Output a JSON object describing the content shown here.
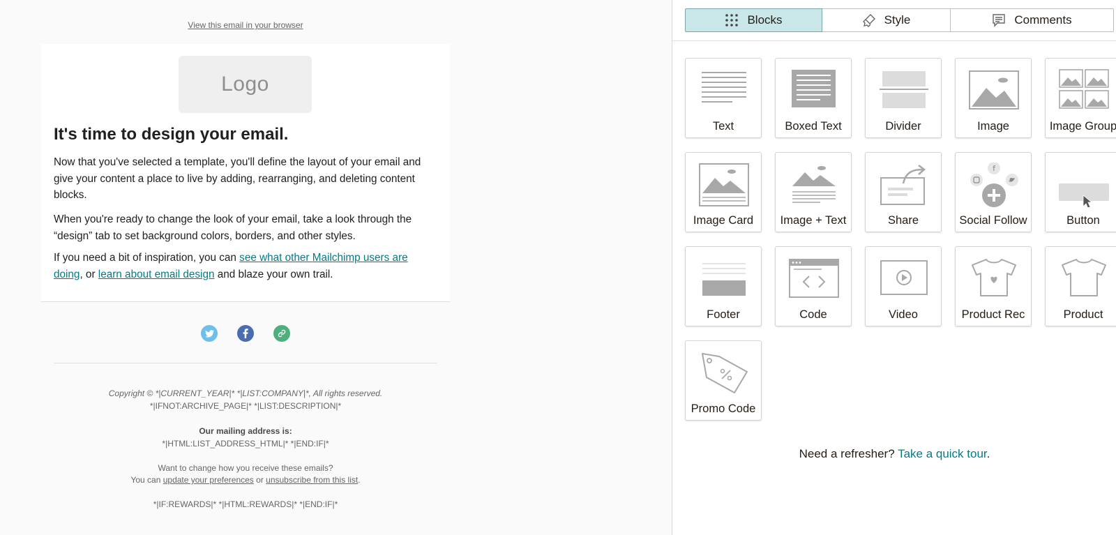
{
  "email": {
    "browser_link": "View this email in your browser",
    "logo_text": "Logo",
    "headline": "It's time to design your email.",
    "paragraph1": "Now that you've selected a template, you'll define the layout of your email and give your content a place to live by adding, rearranging, and deleting content blocks.",
    "paragraph2": "When you're ready to change the look of your email, take a look through the “design” tab to set background colors, borders, and other styles.",
    "paragraph3": {
      "before": "If you need a bit of inspiration, you can ",
      "link1": "see what other Mailchimp users are doing",
      "middle": ", or ",
      "link2": "learn about email design",
      "after": " and blaze your own trail."
    },
    "social_icons": [
      "twitter-icon",
      "facebook-icon",
      "link-icon"
    ],
    "footer": {
      "copyright": "Copyright © *|CURRENT_YEAR|* *|LIST:COMPANY|*, All rights reserved.",
      "description": "*|IFNOT:ARCHIVE_PAGE|* *|LIST:DESCRIPTION|*",
      "address_heading": "Our mailing address is:",
      "address": "*|HTML:LIST_ADDRESS_HTML|* *|END:IF|*",
      "change_prompt": "Want to change how you receive these emails?",
      "you_can": "You can ",
      "update_link": "update your preferences",
      "or_text": " or ",
      "unsubscribe_link": "unsubscribe from this list",
      "period": ".",
      "rewards": "*|IF:REWARDS|* *|HTML:REWARDS|* *|END:IF|*"
    }
  },
  "panel": {
    "tabs": [
      {
        "label": "Blocks",
        "icon": "grid-icon",
        "active": true
      },
      {
        "label": "Style",
        "icon": "paintbrush-icon",
        "active": false
      },
      {
        "label": "Comments",
        "icon": "comment-icon",
        "active": false
      }
    ],
    "blocks": [
      {
        "label": "Text",
        "icon": "text-block-icon"
      },
      {
        "label": "Boxed Text",
        "icon": "boxed-text-block-icon"
      },
      {
        "label": "Divider",
        "icon": "divider-block-icon"
      },
      {
        "label": "Image",
        "icon": "image-block-icon"
      },
      {
        "label": "Image Group",
        "icon": "image-group-block-icon"
      },
      {
        "label": "Image Card",
        "icon": "image-card-block-icon"
      },
      {
        "label": "Image + Text",
        "icon": "image-text-block-icon"
      },
      {
        "label": "Share",
        "icon": "share-block-icon"
      },
      {
        "label": "Social Follow",
        "icon": "social-follow-block-icon"
      },
      {
        "label": "Button",
        "icon": "button-block-icon"
      },
      {
        "label": "Footer",
        "icon": "footer-block-icon"
      },
      {
        "label": "Code",
        "icon": "code-block-icon"
      },
      {
        "label": "Video",
        "icon": "video-block-icon"
      },
      {
        "label": "Product Rec",
        "icon": "product-rec-block-icon"
      },
      {
        "label": "Product",
        "icon": "product-block-icon"
      },
      {
        "label": "Promo Code",
        "icon": "promo-code-block-icon"
      }
    ],
    "refresher_text": "Need a refresher? ",
    "tour_link": "Take a quick tour",
    "tour_period": "."
  },
  "colors": {
    "accent_teal": "#007c89",
    "active_tab_bg": "#c9e6e8",
    "icon_gray": "#a8a8a8",
    "twitter": "#6ebfe9",
    "facebook": "#4a6db0",
    "link": "#4daf7c"
  }
}
